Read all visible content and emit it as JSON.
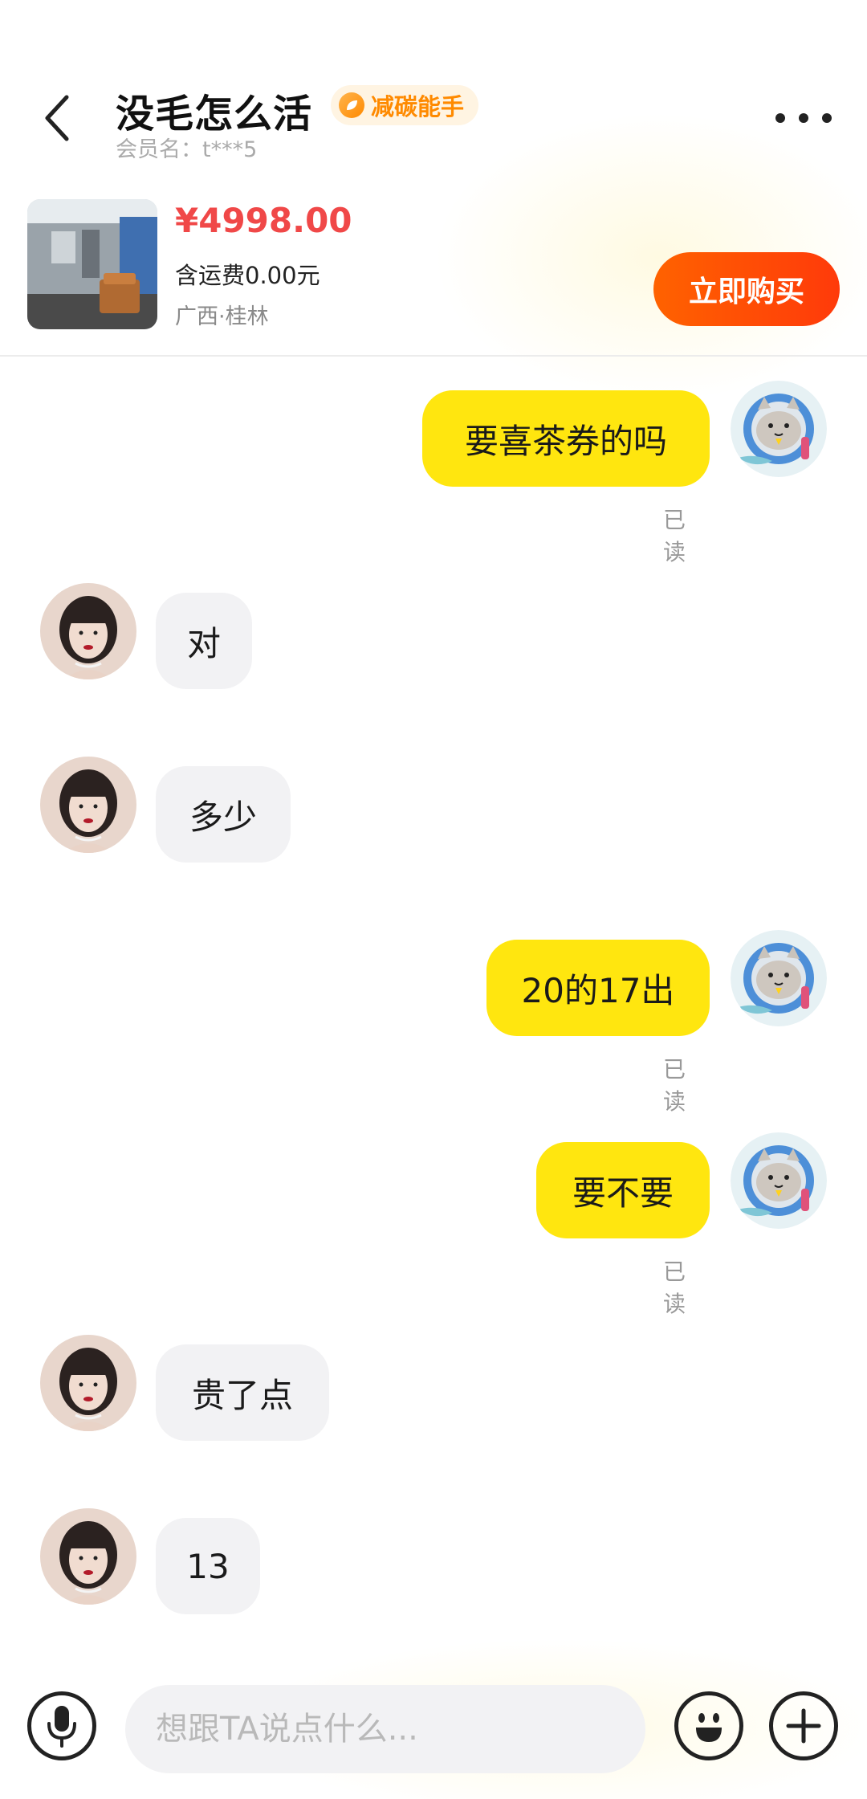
{
  "header": {
    "title": "没毛怎么活",
    "badge": "减碳能手",
    "member": "会员名：t***5"
  },
  "product": {
    "price": "¥4998.00",
    "shipping": "含运费0.00元",
    "location": "广西·桂林",
    "buy_label": "立即购买"
  },
  "messages": [
    {
      "from": "me",
      "text": "要喜茶券的吗",
      "status": "已读"
    },
    {
      "from": "them",
      "text": "对"
    },
    {
      "from": "them",
      "text": "多少"
    },
    {
      "from": "me",
      "text": "20的17出",
      "status": "已读"
    },
    {
      "from": "me",
      "text": "要不要",
      "status": "已读"
    },
    {
      "from": "them",
      "text": "贵了点"
    },
    {
      "from": "them",
      "text": "13"
    }
  ],
  "composer": {
    "placeholder": "想跟TA说点什么..."
  },
  "colors": {
    "my_bubble": "#ffe60f",
    "their_bubble": "#f2f2f4",
    "price": "#f04848",
    "buy_button": "#ff4d06",
    "badge": "#ff8a00"
  }
}
